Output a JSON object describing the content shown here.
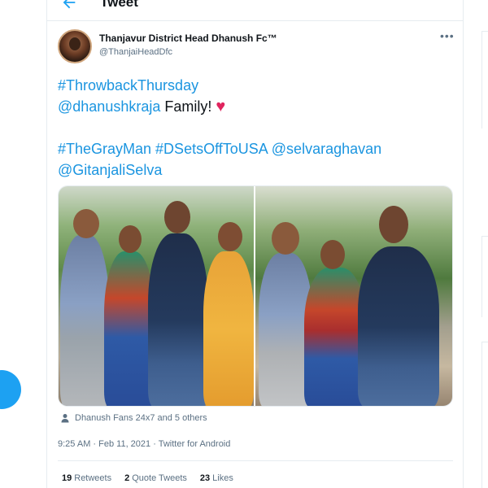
{
  "header": {
    "title": "Tweet",
    "back_icon": "back-arrow-icon"
  },
  "author": {
    "display_name": "Thanjavur District Head Dhanush Fc™",
    "handle": "@ThanjaiHeadDfc",
    "avatar_icon": "avatar"
  },
  "more_icon": "•••",
  "tweet": {
    "line1": "#ThrowbackThursday",
    "line2_mention": "@dhanushkraja",
    "line2_text": " Family! ",
    "line2_emoji": "♥",
    "line3": "#TheGrayMan #DSetsOffToUSA @selvaraghavan",
    "line4": "@GitanjaliSelva"
  },
  "media": {
    "count": 2
  },
  "social_context": "Dhanush Fans 24x7 and 5 others",
  "timestamp": "9:25 AM · Feb 11, 2021 · Twitter for Android",
  "stats": {
    "retweets_count": "19",
    "retweets_label": "Retweets",
    "quotes_count": "2",
    "quotes_label": "Quote Tweets",
    "likes_count": "23",
    "likes_label": "Likes"
  },
  "colors": {
    "accent": "#1da1f2",
    "link": "#1b95e0",
    "heart": "#e0245e"
  }
}
